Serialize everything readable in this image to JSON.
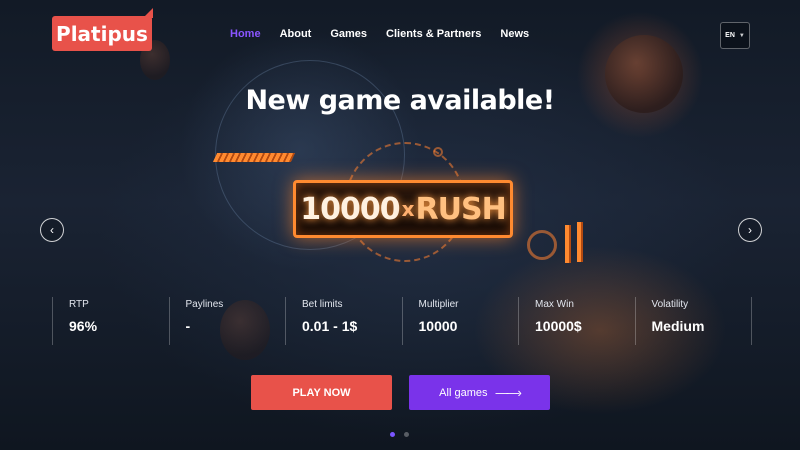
{
  "header": {
    "logo_text": "Platipus",
    "nav": [
      {
        "label": "Home",
        "active": true
      },
      {
        "label": "About",
        "active": false
      },
      {
        "label": "Games",
        "active": false
      },
      {
        "label": "Clients & Partners",
        "active": false
      },
      {
        "label": "News",
        "active": false
      }
    ],
    "language": "EN"
  },
  "hero": {
    "title": "New game available!",
    "game_logo": {
      "number": "10000",
      "x": "x",
      "word": "RUSH"
    },
    "prev_icon": "chevron-left-icon",
    "next_icon": "chevron-right-icon"
  },
  "stats": [
    {
      "label": "RTP",
      "value": "96%"
    },
    {
      "label": "Paylines",
      "value": "-"
    },
    {
      "label": "Bet limits",
      "value": "0.01 - 1$"
    },
    {
      "label": "Multiplier",
      "value": "10000"
    },
    {
      "label": "Max Win",
      "value": "10000$"
    },
    {
      "label": "Volatility",
      "value": "Medium"
    }
  ],
  "buttons": {
    "play": "PLAY NOW",
    "all_games": "All games",
    "all_games_icon": "arrow-right-icon"
  },
  "carousel": {
    "slides": 2,
    "active_index": 0
  },
  "colors": {
    "brand": "#e8524a",
    "accent": "#7a33ea",
    "nav_active": "#8a55ff",
    "game_glow": "#ff8a30"
  }
}
